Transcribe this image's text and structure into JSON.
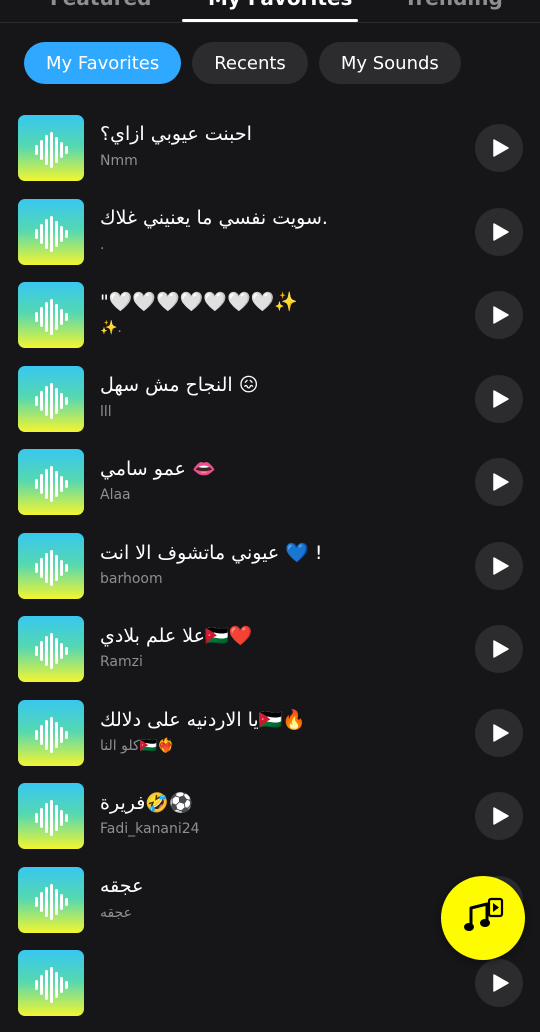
{
  "top_tabs": [
    "Featured",
    "My Favorites",
    "Trending"
  ],
  "chips": [
    "My Favorites",
    "Recents",
    "My Sounds"
  ],
  "sounds": [
    {
      "title": "احبنت عيوبي ازاي؟",
      "artist": "Nmm"
    },
    {
      "title": "سويت نفسي ما يعنيني غلاك.",
      "artist": "."
    },
    {
      "title": "\"🤍🤍🤍🤍🤍🤍🤍✨",
      "artist": "✨."
    },
    {
      "title": "النجاح مش سهل 😖",
      "artist": "lll"
    },
    {
      "title": "عمو سامي 👄",
      "artist": "Alaa"
    },
    {
      "title": "عيوني ماتشوف الا انت 💙 !",
      "artist": "barhoom"
    },
    {
      "title": "علا علم بلادي🇯🇴❤️",
      "artist": "Ramzi"
    },
    {
      "title": "يا الاردنيه على دلالك🇯🇴🔥",
      "artist": "كلو النا🇯🇴❤️‍🔥"
    },
    {
      "title": "فريرة🤣⚽",
      "artist": "Fadi_kanani24"
    },
    {
      "title": "عجقه",
      "artist": "عجقه"
    },
    {
      "title": "",
      "artist": ""
    }
  ],
  "colors": {
    "background": "#161618",
    "active_chip": "#2fa8ff",
    "chip": "#2c2c2e",
    "fab": "#fffc00"
  },
  "icons": {
    "thumb": "waveform-icon",
    "play": "play-icon",
    "fab": "music-video-icon"
  }
}
